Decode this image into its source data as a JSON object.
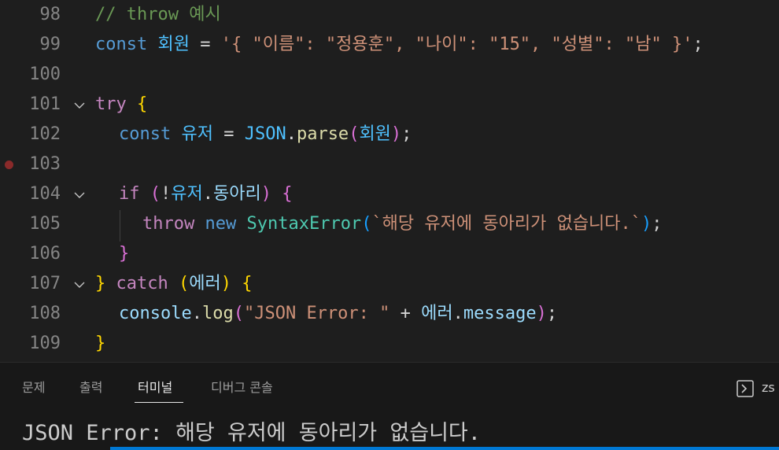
{
  "editor": {
    "lines": [
      {
        "num": "98",
        "tokens": [
          {
            "t": "// throw 예시",
            "c": "t-comment"
          }
        ]
      },
      {
        "num": "99",
        "tokens": [
          {
            "t": "const",
            "c": "t-kw"
          },
          {
            "t": " ",
            "c": "t-op"
          },
          {
            "t": "회원",
            "c": "t-const"
          },
          {
            "t": " = ",
            "c": "t-op"
          },
          {
            "t": "'{ \"이름\": \"정용훈\", \"나이\": \"15\", \"성별\": \"남\" }'",
            "c": "t-str"
          },
          {
            "t": ";",
            "c": "t-op"
          }
        ]
      },
      {
        "num": "100",
        "tokens": []
      },
      {
        "num": "101",
        "fold": true,
        "tokens": [
          {
            "t": "try",
            "c": "t-ctrl"
          },
          {
            "t": " ",
            "c": "t-op"
          },
          {
            "t": "{",
            "c": "t-b1"
          }
        ]
      },
      {
        "num": "102",
        "indent": 1,
        "tokens": [
          {
            "t": "const",
            "c": "t-kw"
          },
          {
            "t": " ",
            "c": "t-op"
          },
          {
            "t": "유저",
            "c": "t-const"
          },
          {
            "t": " = ",
            "c": "t-op"
          },
          {
            "t": "JSON",
            "c": "t-const"
          },
          {
            "t": ".",
            "c": "t-op"
          },
          {
            "t": "parse",
            "c": "t-fn"
          },
          {
            "t": "(",
            "c": "t-b2"
          },
          {
            "t": "회원",
            "c": "t-const"
          },
          {
            "t": ")",
            "c": "t-b2"
          },
          {
            "t": ";",
            "c": "t-op"
          }
        ]
      },
      {
        "num": "103",
        "breakpoint": true,
        "tokens": []
      },
      {
        "num": "104",
        "fold": true,
        "indent": 1,
        "tokens": [
          {
            "t": "if",
            "c": "t-ctrl"
          },
          {
            "t": " ",
            "c": "t-op"
          },
          {
            "t": "(",
            "c": "t-b2"
          },
          {
            "t": "!",
            "c": "t-op"
          },
          {
            "t": "유저",
            "c": "t-const"
          },
          {
            "t": ".",
            "c": "t-op"
          },
          {
            "t": "동아리",
            "c": "t-var"
          },
          {
            "t": ")",
            "c": "t-b2"
          },
          {
            "t": " ",
            "c": "t-op"
          },
          {
            "t": "{",
            "c": "t-b2"
          }
        ]
      },
      {
        "num": "105",
        "indent": 2,
        "tokens": [
          {
            "t": "throw",
            "c": "t-ctrl"
          },
          {
            "t": " ",
            "c": "t-op"
          },
          {
            "t": "new",
            "c": "t-kw"
          },
          {
            "t": " ",
            "c": "t-op"
          },
          {
            "t": "SyntaxError",
            "c": "t-cls"
          },
          {
            "t": "(",
            "c": "t-b3"
          },
          {
            "t": "`해당 유저에 동아리가 없습니다.`",
            "c": "t-str"
          },
          {
            "t": ")",
            "c": "t-b3"
          },
          {
            "t": ";",
            "c": "t-op"
          }
        ]
      },
      {
        "num": "106",
        "indent": 1,
        "tokens": [
          {
            "t": "}",
            "c": "t-b2"
          }
        ]
      },
      {
        "num": "107",
        "fold": true,
        "tokens": [
          {
            "t": "}",
            "c": "t-b1"
          },
          {
            "t": " ",
            "c": "t-op"
          },
          {
            "t": "catch",
            "c": "t-ctrl"
          },
          {
            "t": " ",
            "c": "t-op"
          },
          {
            "t": "(",
            "c": "t-b1"
          },
          {
            "t": "에러",
            "c": "t-var"
          },
          {
            "t": ")",
            "c": "t-b1"
          },
          {
            "t": " ",
            "c": "t-op"
          },
          {
            "t": "{",
            "c": "t-b1"
          }
        ]
      },
      {
        "num": "108",
        "indent": 1,
        "tokens": [
          {
            "t": "console",
            "c": "t-var"
          },
          {
            "t": ".",
            "c": "t-op"
          },
          {
            "t": "log",
            "c": "t-fn"
          },
          {
            "t": "(",
            "c": "t-b2"
          },
          {
            "t": "\"JSON Error: \"",
            "c": "t-str"
          },
          {
            "t": " + ",
            "c": "t-op"
          },
          {
            "t": "에러",
            "c": "t-var"
          },
          {
            "t": ".",
            "c": "t-op"
          },
          {
            "t": "message",
            "c": "t-var"
          },
          {
            "t": ")",
            "c": "t-b2"
          },
          {
            "t": ";",
            "c": "t-op"
          }
        ]
      },
      {
        "num": "109",
        "tokens": [
          {
            "t": "}",
            "c": "t-b1"
          }
        ]
      }
    ]
  },
  "panel": {
    "tabs": [
      {
        "label": "문제",
        "active": false
      },
      {
        "label": "출력",
        "active": false
      },
      {
        "label": "터미널",
        "active": true
      },
      {
        "label": "디버그 콘솔",
        "active": false
      }
    ],
    "terminal_label": "zs",
    "terminal_output": "JSON Error: 해당 유저에 동아리가 없습니다."
  },
  "colors": {
    "breakpoint": "#8a2a2a",
    "accent": "#0078d4"
  },
  "icons": {
    "fold": "chevron-down-icon",
    "terminal": "terminal-icon"
  }
}
